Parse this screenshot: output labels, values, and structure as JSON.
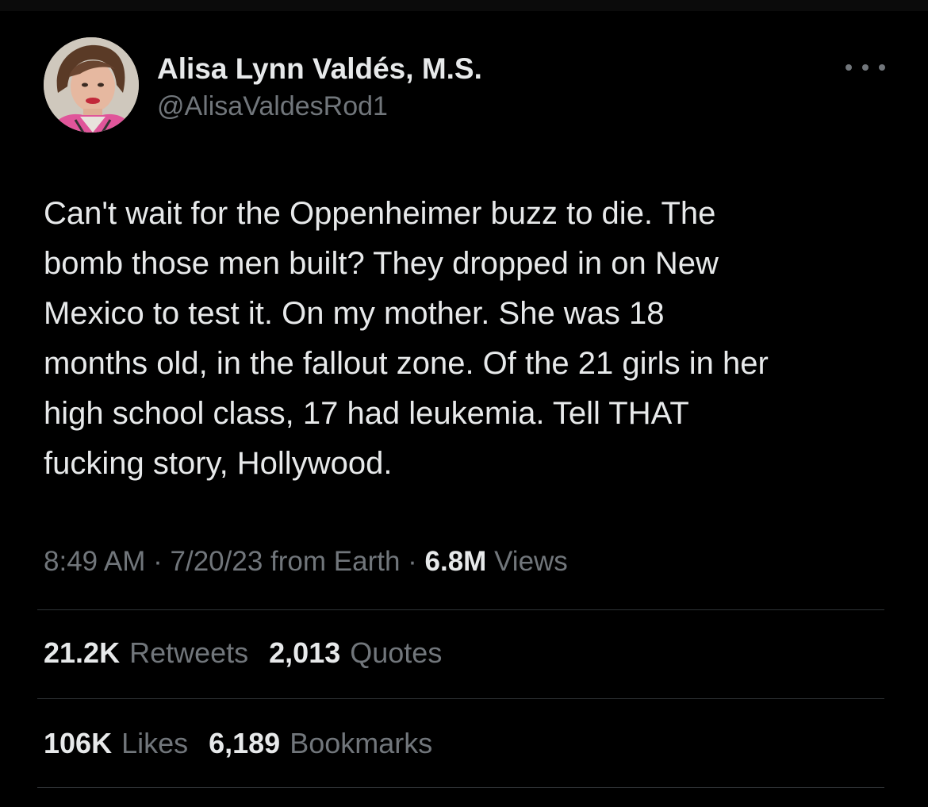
{
  "author": {
    "display_name": "Alisa Lynn Valdés, M.S.",
    "handle": "@AlisaValdesRod1"
  },
  "tweet": {
    "text": "Can't wait for the Oppenheimer buzz to die. The\nbomb those men built? They dropped in on New\nMexico to test it. On my mother. She was 18\nmonths old, in the fallout zone. Of the 21 girls in her\nhigh school class, 17 had leukemia. Tell THAT\nfucking story, Hollywood."
  },
  "meta": {
    "time": "8:49 AM",
    "sep1": " · ",
    "date_source": "7/20/23 from Earth",
    "sep2": " · ",
    "views_count": "6.8M",
    "views_label": "Views"
  },
  "stats": {
    "retweets_count": "21.2K",
    "retweets_label": "Retweets",
    "quotes_count": "2,013",
    "quotes_label": "Quotes",
    "likes_count": "106K",
    "likes_label": "Likes",
    "bookmarks_count": "6,189",
    "bookmarks_label": "Bookmarks"
  },
  "icons": {
    "more": "more-horizontal-icon"
  },
  "colors": {
    "background": "#000000",
    "text_primary": "#e7e9ea",
    "text_secondary": "#71767b",
    "divider": "#2f3336"
  }
}
